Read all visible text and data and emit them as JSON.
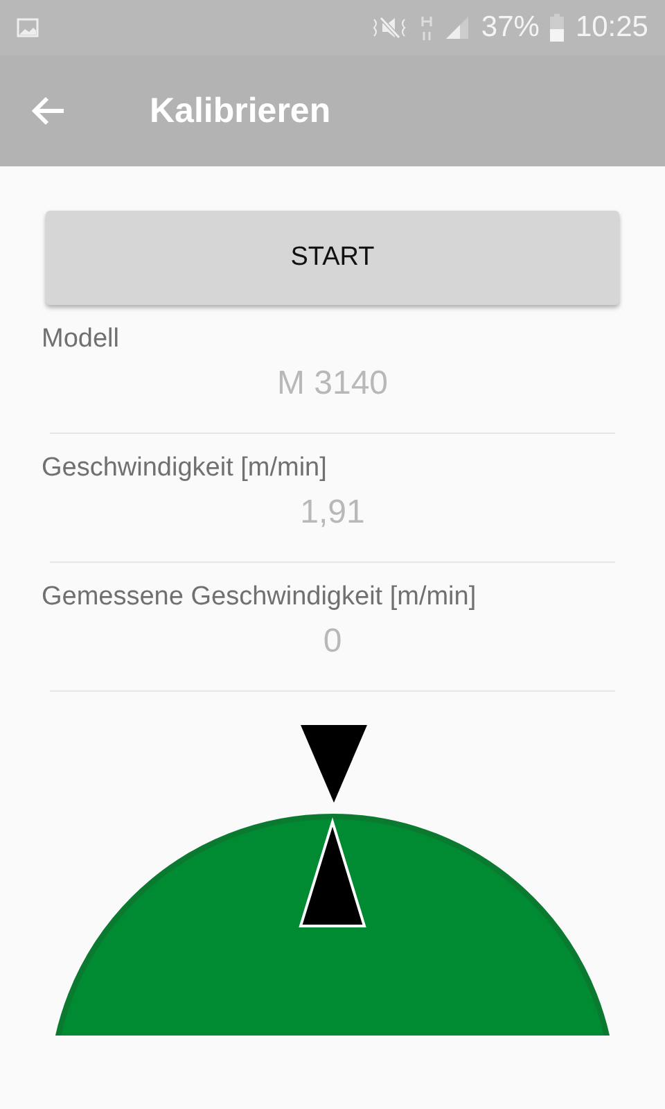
{
  "status_bar": {
    "battery": "37%",
    "time": "10:25"
  },
  "app_bar": {
    "title": "Kalibrieren"
  },
  "start_button": "START",
  "fields": [
    {
      "label": "Modell",
      "value": "M 3140"
    },
    {
      "label": "Geschwindigkeit [m/min]",
      "value": "1,91"
    },
    {
      "label": "Gemessene Geschwindigkeit [m/min]",
      "value": "0"
    }
  ]
}
